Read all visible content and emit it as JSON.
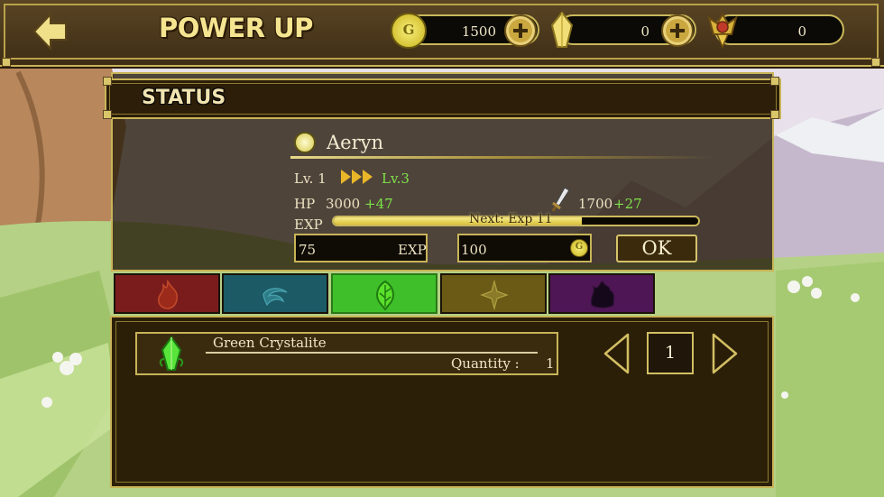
{
  "header": {
    "title": "POWER UP",
    "gold": {
      "symbol": "G",
      "value": "1500"
    },
    "crystal": {
      "value": "0"
    },
    "medal": {
      "value": "0"
    }
  },
  "status": {
    "heading": "STATUS",
    "hero_name": "Aeryn",
    "level_current": "Lv. 1",
    "level_next": "Lv.3",
    "hp_label": "HP",
    "hp_value": "3000",
    "hp_bonus": "+47",
    "atk_value": "1700",
    "atk_bonus": "+27",
    "exp_label": "EXP",
    "exp_next_text": "Next: Exp 11",
    "exp_progress": 0.68,
    "exp_input_value": "75",
    "exp_input_unit": "EXP",
    "cost_value": "100",
    "cost_symbol": "G",
    "ok_label": "OK"
  },
  "element_tabs": [
    {
      "name": "fire",
      "color": "#7a1c1c",
      "active": false
    },
    {
      "name": "water",
      "color": "#1c5a66",
      "active": false
    },
    {
      "name": "nature",
      "color": "#3fbf2a",
      "active": true
    },
    {
      "name": "light",
      "color": "#6a5a16",
      "active": false
    },
    {
      "name": "dark",
      "color": "#4e1655",
      "active": false
    }
  ],
  "items": [
    {
      "name": "Green Crystalite",
      "quantity_label": "Quantity :",
      "quantity": "1"
    }
  ],
  "selector": {
    "value": "1"
  },
  "colors": {
    "accent_gold": "#c8b458",
    "green_text": "#7fe34a"
  }
}
